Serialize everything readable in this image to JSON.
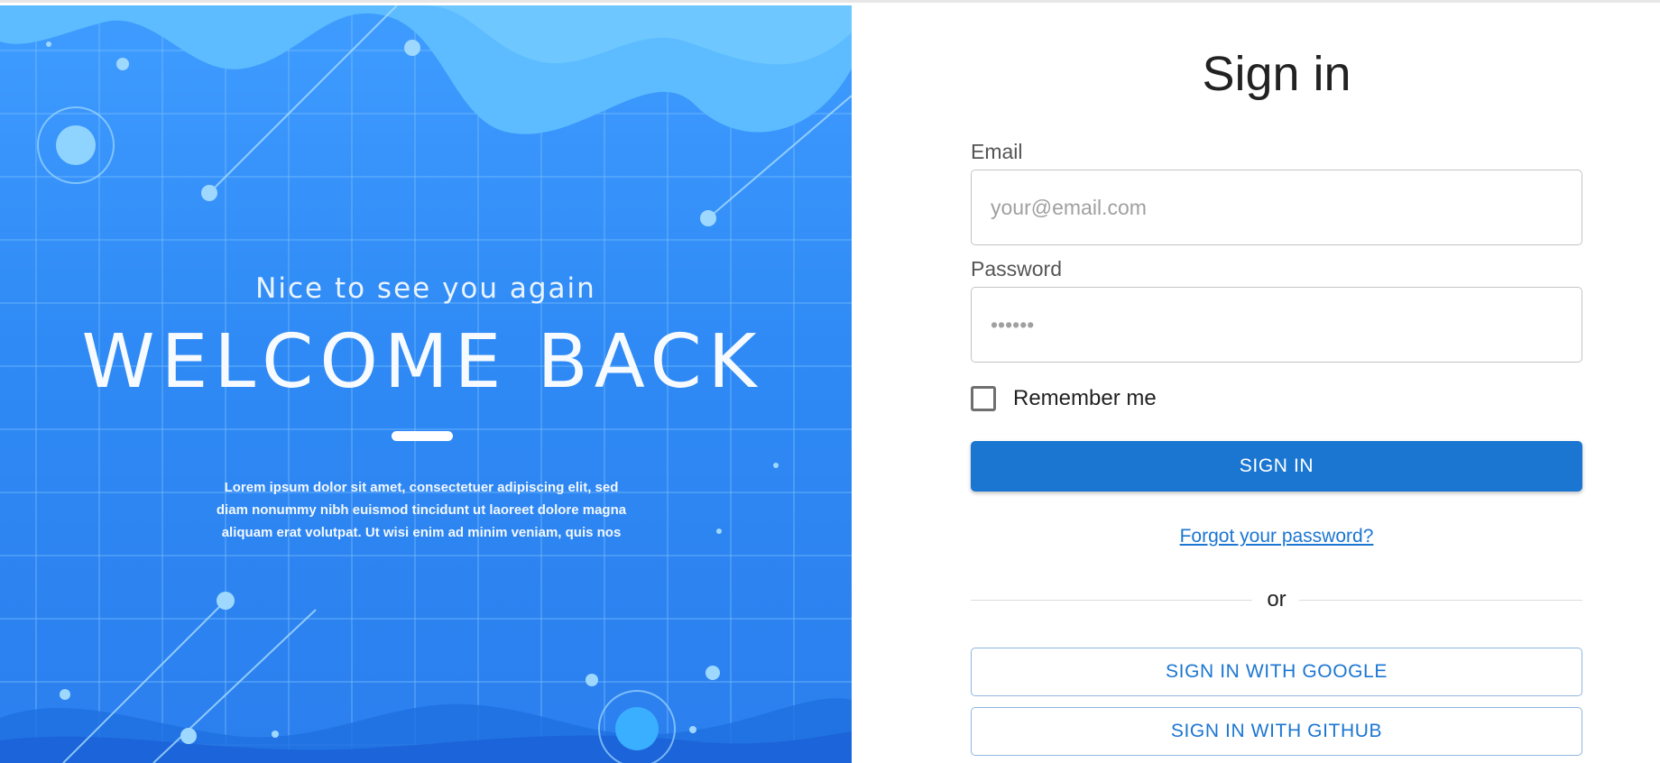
{
  "hero": {
    "subtitle": "Nice to see you again",
    "title": "WELCOME BACK",
    "body_lines": [
      "Lorem ipsum dolor sit amet, consectetuer adipiscing elit, sed",
      "diam nonummy nibh euismod tincidunt ut laoreet dolore magna",
      "aliquam erat volutpat. Ut wisi enim ad minim veniam, quis nos"
    ]
  },
  "form": {
    "title": "Sign in",
    "email": {
      "label": "Email",
      "placeholder": "your@email.com",
      "value": ""
    },
    "password": {
      "label": "Password",
      "placeholder": "••••••",
      "value": ""
    },
    "remember_label": "Remember me",
    "remember_checked": false,
    "submit_label": "SIGN IN",
    "forgot_label": "Forgot your password?",
    "divider_text": "or",
    "google_label": "SIGN IN WITH GOOGLE",
    "github_label": "SIGN IN WITH GITHUB"
  },
  "colors": {
    "primary": "#1b76d2",
    "hero_blue": "#2f8af5"
  }
}
